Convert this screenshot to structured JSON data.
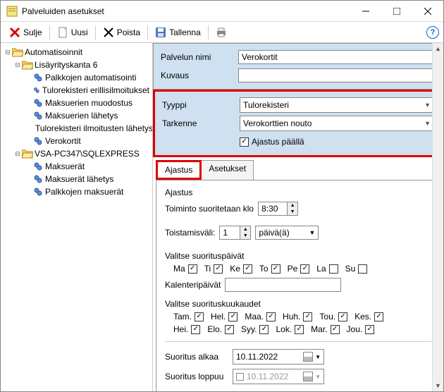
{
  "window": {
    "title": "Palveluiden asetukset"
  },
  "toolbar": {
    "close": "Sulje",
    "new": "Uusi",
    "delete": "Poista",
    "save": "Tallenna"
  },
  "tree": {
    "root": "Automatisoinnit",
    "group1": "Lisäyrityskanta 6",
    "g1items": [
      "Palkkojen automatisointi",
      "Tulorekisteri erillisilmoitukset",
      "Maksuerien muodostus",
      "Maksuerien lähetys",
      "Tulorekisteri ilmoitusten lähetys",
      "Verokortit"
    ],
    "group2": "VSA-PC347\\SQLEXPRESS",
    "g2items": [
      "Maksuerät",
      "Maksuerät lähetys",
      "Palkkojen maksuerät"
    ]
  },
  "form": {
    "nameLabel": "Palvelun nimi",
    "nameValue": "Verokortit",
    "descLabel": "Kuvaus",
    "descValue": "",
    "typeLabel": "Tyyppi",
    "typeValue": "Tulorekisteri",
    "specLabel": "Tarkenne",
    "specValue": "Verokorttien nouto",
    "schedOn": "Ajastus päällä"
  },
  "tabs": {
    "t1": "Ajastus",
    "t2": "Asetukset"
  },
  "sched": {
    "group": "Ajastus",
    "runAtLabel": "Toiminto suoritetaan klo",
    "runAtValue": "8:30",
    "repeatLabel": "Toistamisväli:",
    "repeatValue": "1",
    "repeatUnit": "päivä(ä)",
    "daysLabel": "Valitse suorituspäivät",
    "days": [
      "Ma",
      "Ti",
      "Ke",
      "To",
      "Pe",
      "La",
      "Su"
    ],
    "daysChecked": [
      true,
      true,
      true,
      true,
      true,
      false,
      false
    ],
    "calDaysLabel": "Kalenteripäivät",
    "calDaysValue": "",
    "monthsLabel": "Valitse suorituskuukaudet",
    "months1": [
      "Tam.",
      "Hel.",
      "Maa.",
      "Huh.",
      "Tou.",
      "Kes."
    ],
    "months2": [
      "Hei.",
      "Elo.",
      "Syy.",
      "Lok.",
      "Mar.",
      "Jou."
    ],
    "startLabel": "Suoritus alkaa",
    "startValue": "10.11.2022",
    "endLabel": "Suoritus loppuu",
    "endValue": "10.11.2022"
  }
}
